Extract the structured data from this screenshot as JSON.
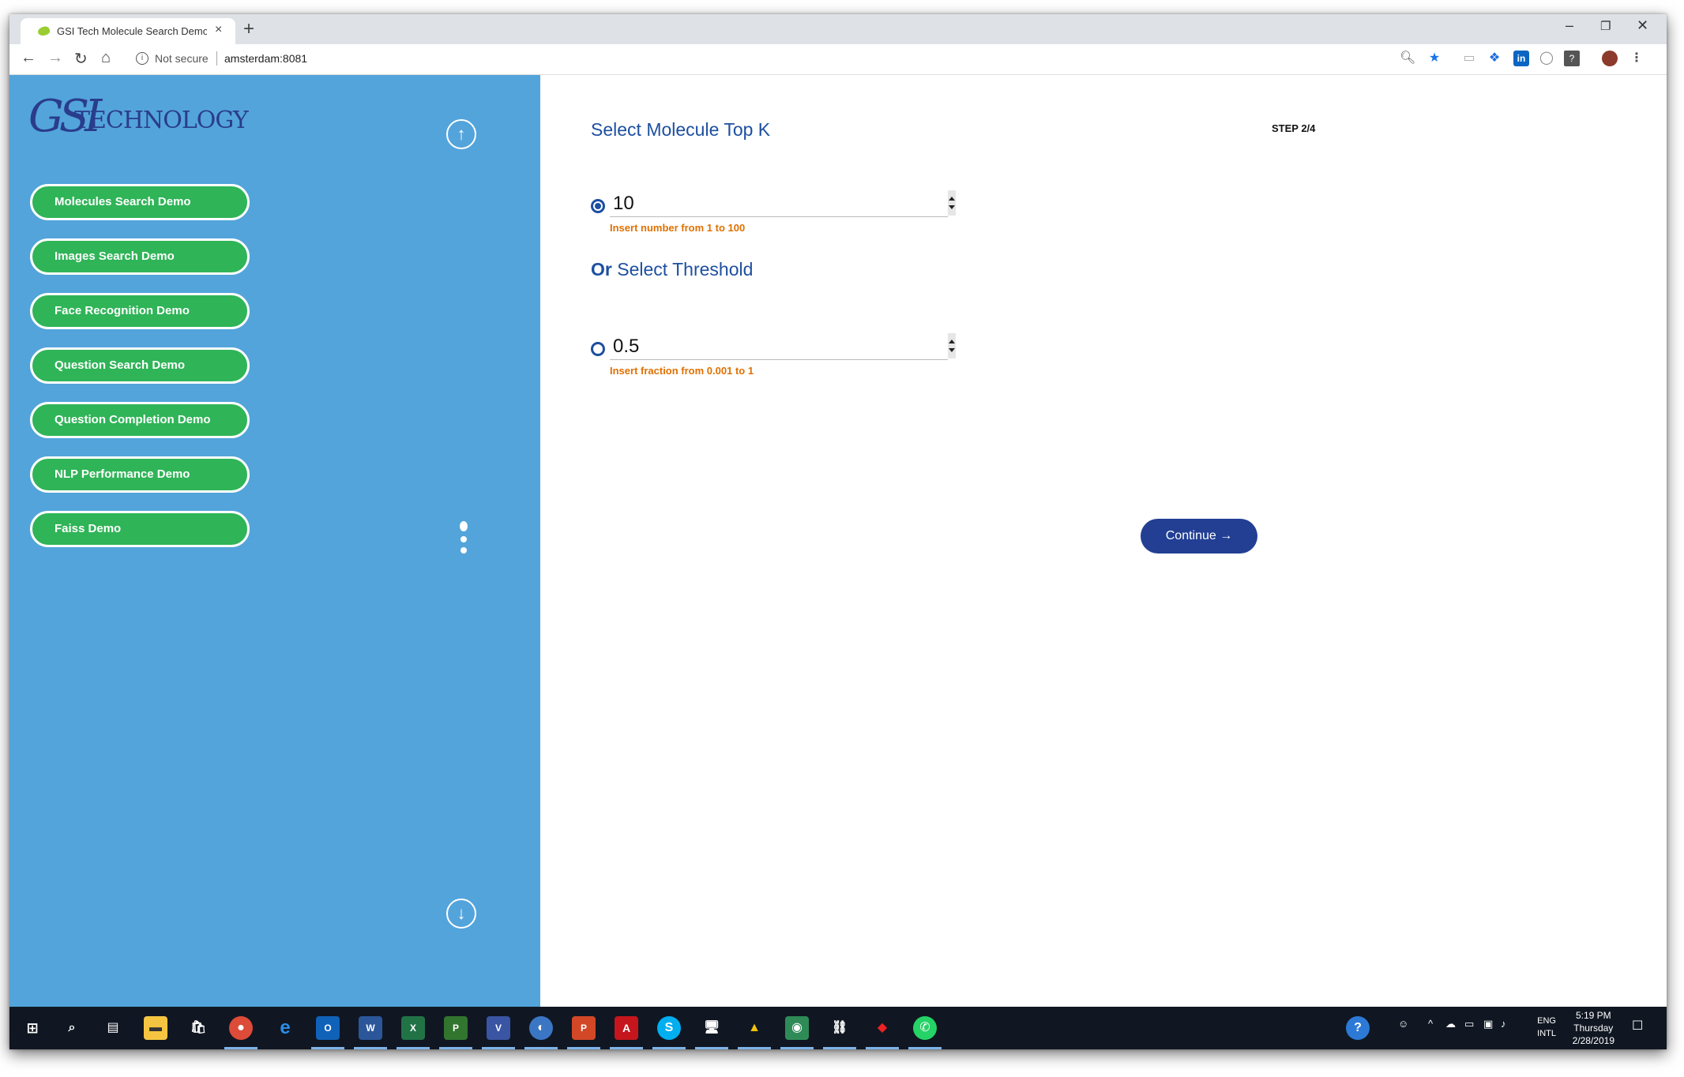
{
  "browser": {
    "tab_title": "GSI Tech Molecule Search Demo",
    "tab_close": "×",
    "new_tab": "+",
    "window_minimize": "–",
    "window_restore": "❐",
    "window_close": "✕",
    "security_label": "Not secure",
    "url": "amsterdam:8081"
  },
  "sidebar": {
    "logo_mark": "GSI",
    "logo_text": "TECHNOLOGY",
    "menu": [
      "Molecules Search Demo",
      "Images Search Demo",
      "Face Recognition Demo",
      "Question Search Demo",
      "Question Completion Demo",
      "NLP Performance Demo",
      "Faiss Demo"
    ]
  },
  "main": {
    "title": "Select Molecule Top K",
    "step": "STEP 2/4",
    "topk_value": "10",
    "topk_hint": "Insert number from 1 to 100",
    "or_word": "Or",
    "threshold_title": "Select Threshold",
    "threshold_value": "0.5",
    "threshold_hint": "Insert fraction from 0.001 to 1",
    "continue_label": "Continue →",
    "selected_option": "topk"
  },
  "taskbar": {
    "language_line1": "ENG",
    "language_line2": "INTL",
    "time": "5:19 PM",
    "day": "Thursday",
    "date": "2/28/2019"
  },
  "colors": {
    "sidebar_bg": "#53a4db",
    "menu_button": "#2fb457",
    "heading_blue": "#1d4fa0",
    "hint_orange": "#e07000",
    "continue_button": "#223f94",
    "taskbar": "#101722"
  }
}
